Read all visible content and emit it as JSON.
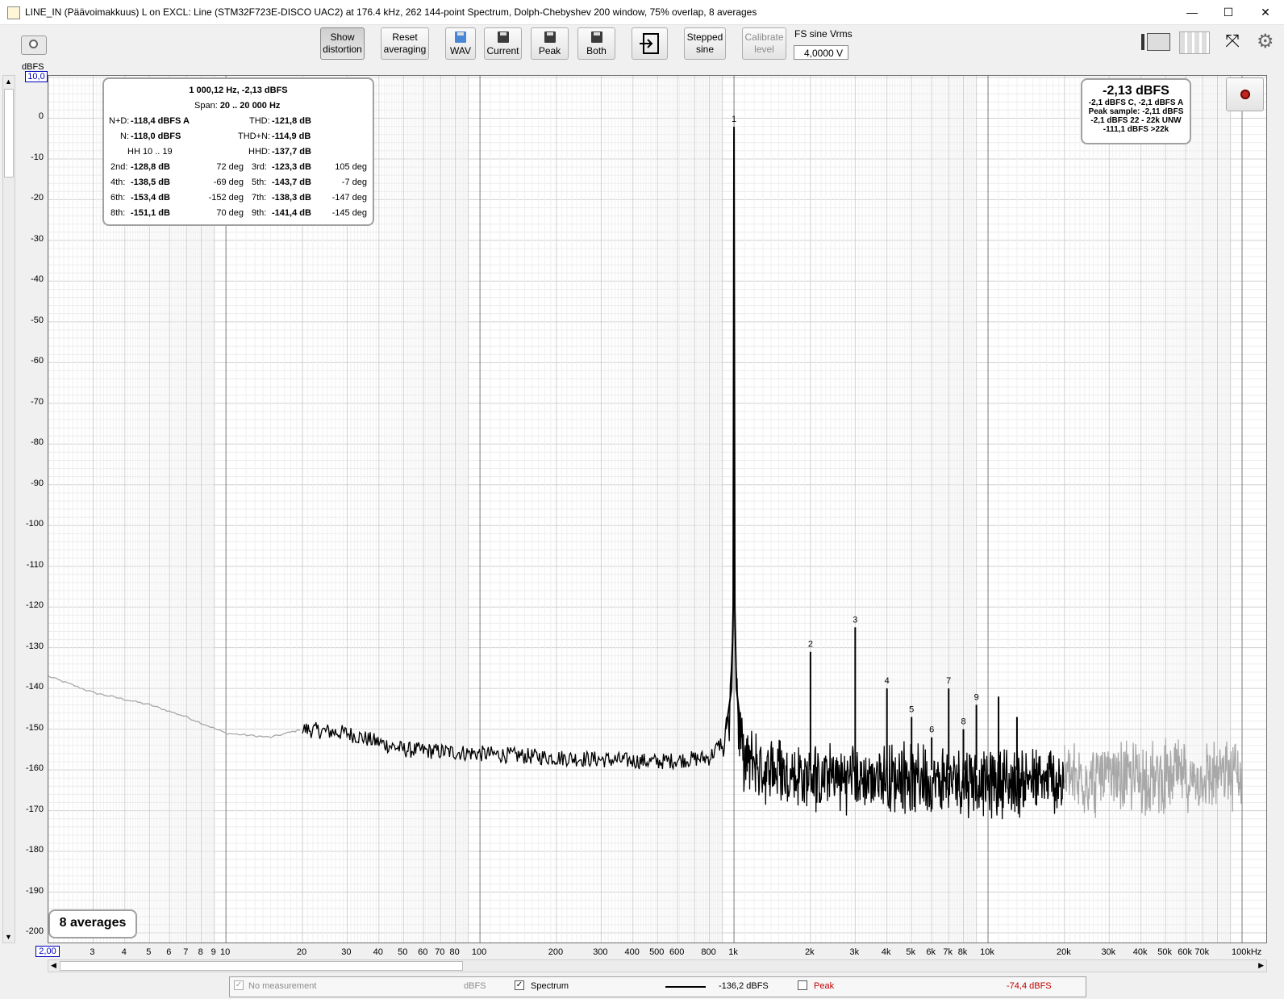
{
  "window": {
    "title": "LINE_IN (Päävoimakkuus) L on EXCL: Line (STM32F723E-DISCO UAC2) at 176.4 kHz, 262 144-point Spectrum, Dolph-Chebyshev 200 window, 75% overlap, 8 averages",
    "minimize": "—",
    "maximize": "☐",
    "close": "✕"
  },
  "toolbar": {
    "show_distortion": [
      "Show",
      "distortion"
    ],
    "reset_averaging": [
      "Reset",
      "averaging"
    ],
    "wav": "WAV",
    "current": "Current",
    "peak": "Peak",
    "both": "Both",
    "stepped_sine": [
      "Stepped",
      "sine"
    ],
    "calibrate_level": [
      "Calibrate",
      "level"
    ],
    "fs_label": "FS sine Vrms",
    "fs_value": "4,0000 V"
  },
  "graph": {
    "y_unit": "dBFS",
    "y_top_box": "10,0",
    "x_left_box": "2,00",
    "y_ticks": [
      "0",
      "-10",
      "-20",
      "-30",
      "-40",
      "-50",
      "-60",
      "-70",
      "-80",
      "-90",
      "-100",
      "-110",
      "-120",
      "-130",
      "-140",
      "-150",
      "-160",
      "-170",
      "-180",
      "-190",
      "-200"
    ],
    "x_ticks": [
      {
        "f": 3,
        "label": "3"
      },
      {
        "f": 4,
        "label": "4"
      },
      {
        "f": 5,
        "label": "5"
      },
      {
        "f": 6,
        "label": "6"
      },
      {
        "f": 7,
        "label": "7"
      },
      {
        "f": 8,
        "label": "8"
      },
      {
        "f": 9,
        "label": "9"
      },
      {
        "f": 10,
        "label": "10"
      },
      {
        "f": 20,
        "label": "20"
      },
      {
        "f": 30,
        "label": "30"
      },
      {
        "f": 40,
        "label": "40"
      },
      {
        "f": 50,
        "label": "50"
      },
      {
        "f": 60,
        "label": "60"
      },
      {
        "f": 70,
        "label": "70"
      },
      {
        "f": 80,
        "label": "80"
      },
      {
        "f": 100,
        "label": "100"
      },
      {
        "f": 200,
        "label": "200"
      },
      {
        "f": 300,
        "label": "300"
      },
      {
        "f": 400,
        "label": "400"
      },
      {
        "f": 500,
        "label": "500"
      },
      {
        "f": 600,
        "label": "600"
      },
      {
        "f": 800,
        "label": "800"
      },
      {
        "f": 1000,
        "label": "1k"
      },
      {
        "f": 2000,
        "label": "2k"
      },
      {
        "f": 3000,
        "label": "3k"
      },
      {
        "f": 4000,
        "label": "4k"
      },
      {
        "f": 5000,
        "label": "5k"
      },
      {
        "f": 6000,
        "label": "6k"
      },
      {
        "f": 7000,
        "label": "7k"
      },
      {
        "f": 8000,
        "label": "8k"
      },
      {
        "f": 10000,
        "label": "10k"
      },
      {
        "f": 20000,
        "label": "20k"
      },
      {
        "f": 30000,
        "label": "30k"
      },
      {
        "f": 40000,
        "label": "40k"
      },
      {
        "f": 50000,
        "label": "50k"
      },
      {
        "f": 60000,
        "label": "60k"
      },
      {
        "f": 70000,
        "label": "70k"
      },
      {
        "f": 100000,
        "label": "100kHz"
      }
    ]
  },
  "chart_data": {
    "type": "line",
    "xlabel": "Hz",
    "ylabel": "dBFS",
    "xscale": "log",
    "xlim": [
      2,
      100000
    ],
    "ylim": [
      -200,
      10
    ],
    "series": [
      {
        "name": "Spectrum",
        "color": "#000000",
        "points": [
          [
            2,
            -137
          ],
          [
            3,
            -141
          ],
          [
            5,
            -144
          ],
          [
            7,
            -147
          ],
          [
            10,
            -151
          ],
          [
            15,
            -152
          ],
          [
            20,
            -150
          ],
          [
            30,
            -151
          ],
          [
            50,
            -155
          ],
          [
            100,
            -156
          ],
          [
            200,
            -157
          ],
          [
            500,
            -158
          ],
          [
            800,
            -157
          ],
          [
            900,
            -153
          ],
          [
            960,
            -146
          ],
          [
            990,
            -120
          ],
          [
            1000,
            -2.1
          ],
          [
            1010,
            -120
          ],
          [
            1040,
            -146
          ],
          [
            1100,
            -154
          ],
          [
            1500,
            -158
          ],
          [
            2000,
            -159
          ],
          [
            5000,
            -159
          ],
          [
            10000,
            -160
          ],
          [
            20000,
            -160
          ],
          [
            50000,
            -159
          ],
          [
            100000,
            -158
          ]
        ]
      }
    ],
    "harmonics": [
      {
        "label": "1",
        "f": 1000,
        "db": -2.1
      },
      {
        "label": "2",
        "f": 2000,
        "db": -131
      },
      {
        "label": "3",
        "f": 3000,
        "db": -125
      },
      {
        "label": "4",
        "f": 4000,
        "db": -140
      },
      {
        "label": "5",
        "f": 5000,
        "db": -147
      },
      {
        "label": "6",
        "f": 6000,
        "db": -152
      },
      {
        "label": "7",
        "f": 7000,
        "db": -140
      },
      {
        "label": "8",
        "f": 8000,
        "db": -150
      },
      {
        "label": "9",
        "f": 9000,
        "db": -144
      }
    ],
    "extra_spurs": [
      {
        "f": 11000,
        "db": -142
      },
      {
        "f": 13000,
        "db": -147
      }
    ],
    "grid": true
  },
  "distortion": {
    "headline": "1 000,12 Hz, -2,13 dBFS",
    "span_label": "Span:",
    "span_value": "20 .. 20 000 Hz",
    "nd_label": "N+D:",
    "nd_value": "-118,4 dBFS A",
    "thd_label": "THD:",
    "thd_value": "-121,8 dB",
    "n_label": "N:",
    "n_value": "-118,0 dBFS",
    "thdn_label": "THD+N:",
    "thdn_value": "-114,9 dB",
    "hh_label": "HH 10 .. 19",
    "hhd_label": "HHD:",
    "hhd_value": "-137,7 dB",
    "rows": [
      {
        "l1": "2nd:",
        "v1": "-128,8 dB",
        "p1": "72 deg",
        "l2": "3rd:",
        "v2": "-123,3 dB",
        "p2": "105 deg"
      },
      {
        "l1": "4th:",
        "v1": "-138,5 dB",
        "p1": "-69 deg",
        "l2": "5th:",
        "v2": "-143,7 dB",
        "p2": "-7 deg"
      },
      {
        "l1": "6th:",
        "v1": "-153,4 dB",
        "p1": "-152 deg",
        "l2": "7th:",
        "v2": "-138,3 dB",
        "p2": "-147 deg"
      },
      {
        "l1": "8th:",
        "v1": "-151,1 dB",
        "p1": "70 deg",
        "l2": "9th:",
        "v2": "-141,4 dB",
        "p2": "-145 deg"
      }
    ]
  },
  "level_box": {
    "main": "-2,13 dBFS",
    "line1": "-2,1 dBFS C, -2,1 dBFS A",
    "line2": "Peak sample: -2,11 dBFS",
    "line3": "-2,1 dBFS 22 - 22k UNW",
    "line4": "-111,1 dBFS >22k"
  },
  "averages_label": "8 averages",
  "legend": {
    "no_measurement": "No measurement",
    "no_measurement_unit": "dBFS",
    "spectrum_label": "Spectrum",
    "spectrum_value": "-136,2 dBFS",
    "peak_label": "Peak",
    "peak_value": "-74,4 dBFS"
  }
}
